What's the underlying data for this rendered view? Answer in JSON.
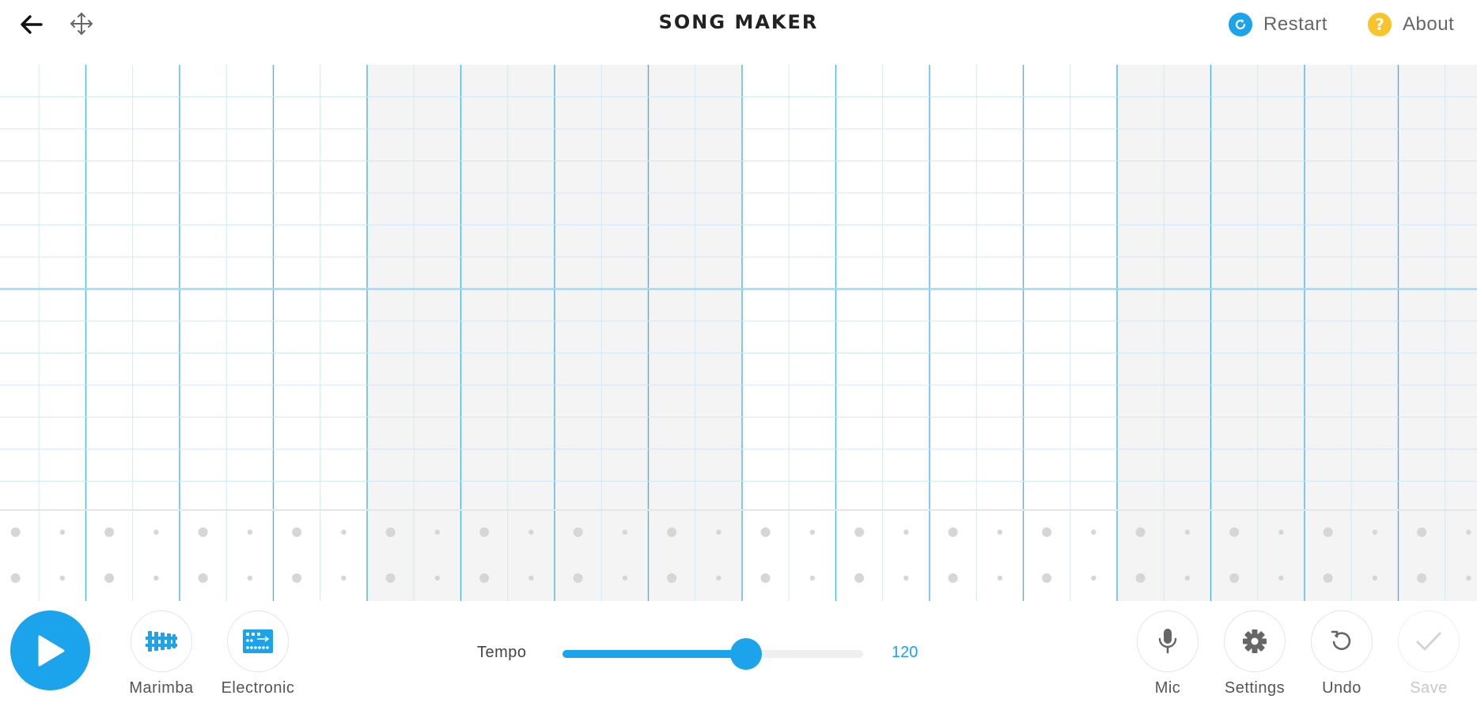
{
  "header": {
    "title": "SONG MAKER",
    "back_icon": "arrow-left-icon",
    "move_icon": "move-arrows-icon",
    "restart": {
      "label": "Restart",
      "icon": "refresh-icon",
      "color": "#1ba3ec"
    },
    "about": {
      "label": "About",
      "icon": "question-icon",
      "glyph": "?",
      "color": "#f9c32b"
    }
  },
  "grid": {
    "bars": 4,
    "beats_per_bar": 4,
    "subdivisions_per_beat": 2,
    "melody_rows": 14,
    "rhythm_rows": 2,
    "shaded_bars": [
      1,
      3
    ],
    "colors": {
      "major_line": "#4db3e6",
      "minor_line": "#cfe9f7",
      "row_line": "#cfe9f7",
      "octave_line": "#a9d6f0",
      "shade": "#f4f4f4",
      "dot": "#d6d6d6"
    }
  },
  "bottom": {
    "play": {
      "icon": "play-icon",
      "color": "#1ba3ec"
    },
    "instruments": [
      {
        "label": "Marimba",
        "icon": "marimba-icon"
      },
      {
        "label": "Electronic",
        "icon": "electronic-drum-icon"
      }
    ],
    "tempo": {
      "label": "Tempo",
      "value": "120",
      "fill_fraction": 0.61
    },
    "tools": [
      {
        "label": "Mic",
        "icon": "microphone-icon"
      },
      {
        "label": "Settings",
        "icon": "gear-icon"
      },
      {
        "label": "Undo",
        "icon": "undo-icon"
      },
      {
        "label": "Save",
        "icon": "check-icon",
        "disabled": true
      }
    ]
  }
}
